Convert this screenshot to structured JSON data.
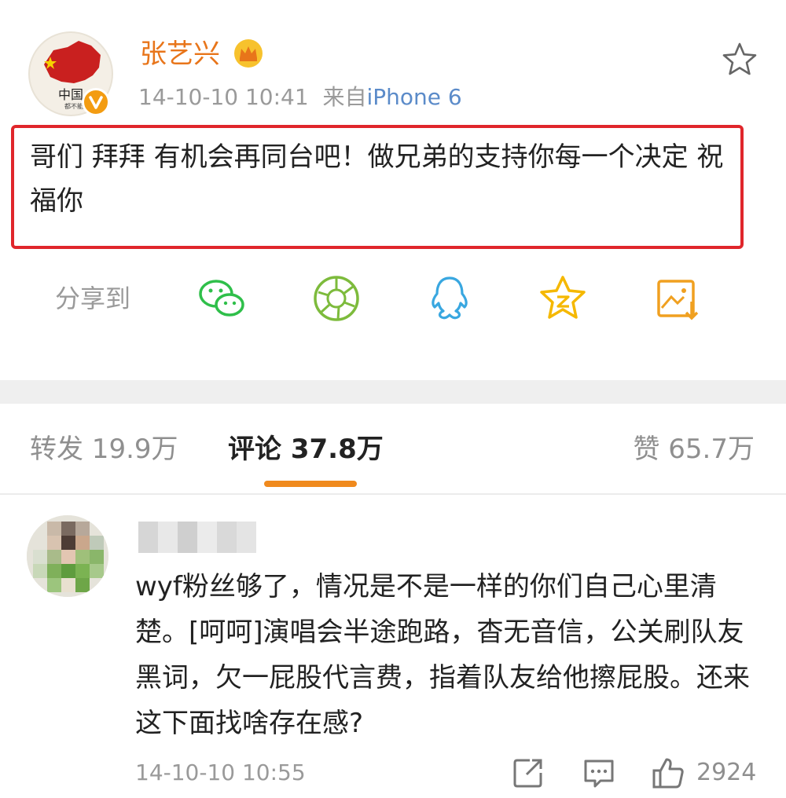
{
  "post": {
    "author": "张艺兴",
    "time": "14-10-10 10:41",
    "source_prefix": "来自",
    "source": "iPhone 6",
    "text": "哥们 拜拜 有机会再同台吧！做兄弟的支持你每一个决定 祝福你",
    "avatar_text": "中国",
    "avatar_subtext": "都不能少"
  },
  "share": {
    "label": "分享到",
    "targets": [
      "wechat-icon",
      "moments-icon",
      "qq-icon",
      "qzone-icon",
      "save-image-icon"
    ]
  },
  "tabs": {
    "repost": "转发 19.9万",
    "comment": "评论 37.8万",
    "like": "赞 65.7万"
  },
  "comment": {
    "text": "wyf粉丝够了，情况是不是一样的你们自己心里清楚。[呵呵]演唱会半途跑路，杳无音信，公关刷队友黑词，欠一屁股代言费，指着队友给他擦屁股。还来这下面找啥存在感?",
    "time": "14-10-10 10:55",
    "likes": "2924"
  },
  "colors": {
    "username": "#e8751a",
    "source_link": "#5b8bc9",
    "highlight_border": "#e0262b",
    "tab_underline": "#f08a1d",
    "wechat": "#2fbf4a",
    "moments": "#7dbb3c",
    "qq": "#39a7e0",
    "qzone": "#f5b800",
    "save": "#f0a020"
  }
}
